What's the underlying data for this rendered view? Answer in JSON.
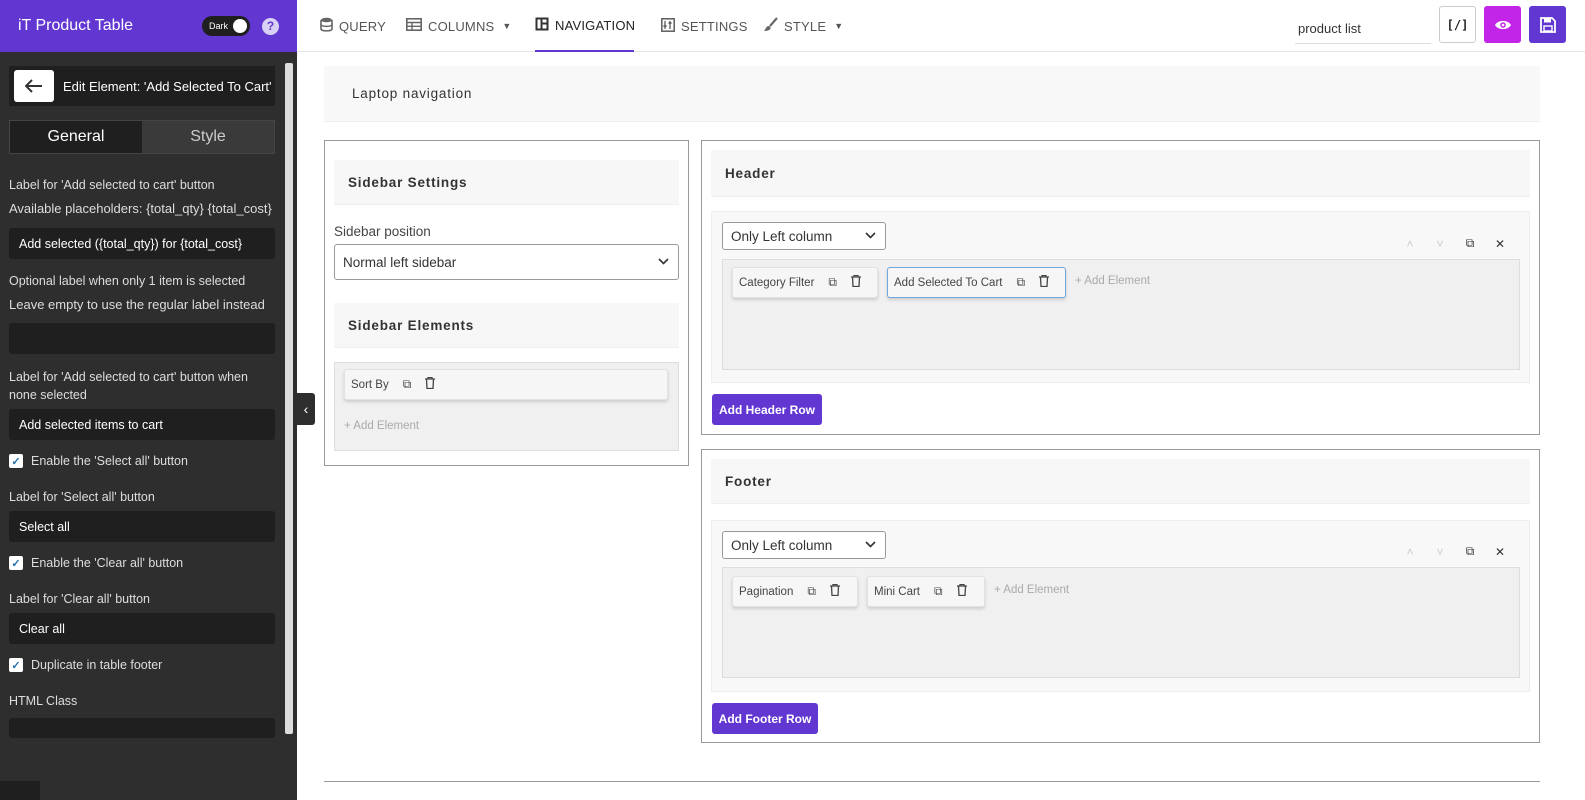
{
  "panel": {
    "title": "iT Product Table",
    "dark_label": "Dark",
    "help_glyph": "?",
    "edit_title": "Edit Element: 'Add Selected To Cart'",
    "tabs": [
      "General",
      "Style"
    ],
    "fields": {
      "label1": "Label for 'Add selected to cart' button",
      "label1_hint": "Available placeholders: {total_qty} {total_cost}",
      "label1_value": "Add selected ({total_qty}) for {total_cost}",
      "label2": "Optional label when only 1 item is selected",
      "label2_hint": "Leave empty to use the regular label instead",
      "label2_value": "",
      "label3": "Label for 'Add selected to cart' button when none selected",
      "label3_value": "Add selected items to cart",
      "check_select_all": "Enable the 'Select all' button",
      "label4": "Label for 'Select all' button",
      "label4_value": "Select all",
      "check_clear_all": "Enable the 'Clear all' button",
      "label5": "Label for 'Clear all' button",
      "label5_value": "Clear all",
      "check_duplicate": "Duplicate in table footer",
      "label6": "HTML Class"
    }
  },
  "topnav": {
    "items": [
      "QUERY",
      "COLUMNS",
      "NAVIGATION",
      "SETTINGS",
      "STYLE"
    ],
    "active": "NAVIGATION",
    "search_value": "product list",
    "code_label": "[/]"
  },
  "main": {
    "section_title": "Laptop navigation",
    "sidebar": {
      "settings_title": "Sidebar Settings",
      "position_label": "Sidebar position",
      "position_value": "Normal left sidebar",
      "elements_title": "Sidebar Elements",
      "elements": [
        "Sort By"
      ],
      "add_element": "+ Add Element"
    },
    "header": {
      "title": "Header",
      "column_select": "Only Left column",
      "elements": [
        "Category Filter",
        "Add Selected To Cart"
      ],
      "add_element": "+ Add Element",
      "add_row": "Add Header Row"
    },
    "footer": {
      "title": "Footer",
      "column_select": "Only Left column",
      "elements": [
        "Pagination",
        "Mini Cart"
      ],
      "add_element": "+ Add Element",
      "add_row": "Add Footer Row"
    }
  },
  "colors": {
    "brand": "#6236d1",
    "preview": "#c224e8",
    "panel_bg": "#2e2e2e"
  }
}
